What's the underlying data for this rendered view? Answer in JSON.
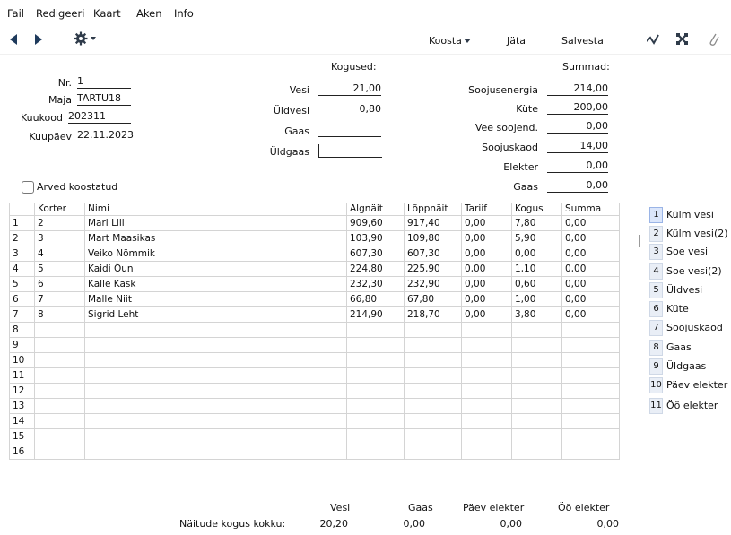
{
  "menu": [
    "Fail",
    "Redigeeri",
    "Kaart",
    "Aken",
    "Info"
  ],
  "toolbar": {
    "koosta": "Koosta",
    "jata": "Jäta",
    "salvesta": "Salvesta"
  },
  "header": {
    "nr": {
      "label": "Nr.",
      "value": "1"
    },
    "maja": {
      "label": "Maja",
      "value": "TARTU18"
    },
    "kuukood": {
      "label": "Kuukood",
      "value": "202311"
    },
    "kuupaev": {
      "label": "Kuupäev",
      "value": "22.11.2023"
    }
  },
  "kogused": {
    "title": "Kogused:",
    "rows": [
      {
        "label": "Vesi",
        "value": "21,00"
      },
      {
        "label": "Üldvesi",
        "value": "0,80"
      },
      {
        "label": "Gaas",
        "value": ""
      },
      {
        "label": "Üldgaas",
        "value": ""
      }
    ]
  },
  "summad": {
    "title": "Summad:",
    "rows": [
      {
        "label": "Soojusenergia",
        "value": "214,00"
      },
      {
        "label": "Küte",
        "value": "200,00"
      },
      {
        "label": "Vee soojend.",
        "value": "0,00"
      },
      {
        "label": "Soojuskaod",
        "value": "14,00"
      },
      {
        "label": "Elekter",
        "value": "0,00"
      },
      {
        "label": "Gaas",
        "value": "0,00"
      }
    ]
  },
  "arved_checkbox_label": "Arved koostatud",
  "table": {
    "columns": [
      "Korter",
      "Nimi",
      "Algnäit",
      "Lõppnäit",
      "Tariif",
      "Kogus",
      "Summa"
    ],
    "rows": [
      {
        "n": "1",
        "korter": "2",
        "nimi": "Mari Lill",
        "alg": "909,60",
        "lopp": "917,40",
        "tariif": "0,00",
        "kogus": "7,80",
        "summa": "0,00"
      },
      {
        "n": "2",
        "korter": "3",
        "nimi": "Mart Maasikas",
        "alg": "103,90",
        "lopp": "109,80",
        "tariif": "0,00",
        "kogus": "5,90",
        "summa": "0,00"
      },
      {
        "n": "3",
        "korter": "4",
        "nimi": "Veiko Nõmmik",
        "alg": "607,30",
        "lopp": "607,30",
        "tariif": "0,00",
        "kogus": "0,00",
        "summa": "0,00"
      },
      {
        "n": "4",
        "korter": "5",
        "nimi": "Kaidi Õun",
        "alg": "224,80",
        "lopp": "225,90",
        "tariif": "0,00",
        "kogus": "1,10",
        "summa": "0,00"
      },
      {
        "n": "5",
        "korter": "6",
        "nimi": "Kalle Kask",
        "alg": "232,30",
        "lopp": "232,90",
        "tariif": "0,00",
        "kogus": "0,60",
        "summa": "0,00"
      },
      {
        "n": "6",
        "korter": "7",
        "nimi": "Malle Niit",
        "alg": "66,80",
        "lopp": "67,80",
        "tariif": "0,00",
        "kogus": "1,00",
        "summa": "0,00"
      },
      {
        "n": "7",
        "korter": "8",
        "nimi": "Sigrid Leht",
        "alg": "214,90",
        "lopp": "218,70",
        "tariif": "0,00",
        "kogus": "3,80",
        "summa": "0,00"
      },
      {
        "n": "8",
        "korter": "",
        "nimi": "",
        "alg": "",
        "lopp": "",
        "tariif": "",
        "kogus": "",
        "summa": ""
      },
      {
        "n": "9",
        "korter": "",
        "nimi": "",
        "alg": "",
        "lopp": "",
        "tariif": "",
        "kogus": "",
        "summa": ""
      },
      {
        "n": "10",
        "korter": "",
        "nimi": "",
        "alg": "",
        "lopp": "",
        "tariif": "",
        "kogus": "",
        "summa": ""
      },
      {
        "n": "11",
        "korter": "",
        "nimi": "",
        "alg": "",
        "lopp": "",
        "tariif": "",
        "kogus": "",
        "summa": ""
      },
      {
        "n": "12",
        "korter": "",
        "nimi": "",
        "alg": "",
        "lopp": "",
        "tariif": "",
        "kogus": "",
        "summa": ""
      },
      {
        "n": "13",
        "korter": "",
        "nimi": "",
        "alg": "",
        "lopp": "",
        "tariif": "",
        "kogus": "",
        "summa": ""
      },
      {
        "n": "14",
        "korter": "",
        "nimi": "",
        "alg": "",
        "lopp": "",
        "tariif": "",
        "kogus": "",
        "summa": ""
      },
      {
        "n": "15",
        "korter": "",
        "nimi": "",
        "alg": "",
        "lopp": "",
        "tariif": "",
        "kogus": "",
        "summa": ""
      },
      {
        "n": "16",
        "korter": "",
        "nimi": "",
        "alg": "",
        "lopp": "",
        "tariif": "",
        "kogus": "",
        "summa": ""
      }
    ]
  },
  "side_tabs": [
    {
      "n": "1",
      "label": "Külm vesi"
    },
    {
      "n": "2",
      "label": "Külm vesi(2)"
    },
    {
      "n": "3",
      "label": "Soe vesi"
    },
    {
      "n": "4",
      "label": "Soe vesi(2)"
    },
    {
      "n": "5",
      "label": "Üldvesi"
    },
    {
      "n": "6",
      "label": "Küte"
    },
    {
      "n": "7",
      "label": "Soojuskaod"
    },
    {
      "n": "8",
      "label": "Gaas"
    },
    {
      "n": "9",
      "label": "Üldgaas"
    },
    {
      "n": "10",
      "label": "Päev elekter"
    },
    {
      "n": "11",
      "label": "Öö elekter"
    }
  ],
  "footer": {
    "label": "Näitude kogus kokku:",
    "cols": [
      {
        "title": "Vesi",
        "value": "20,20"
      },
      {
        "title": "Gaas",
        "value": "0,00"
      },
      {
        "title": "Päev elekter",
        "value": "0,00"
      },
      {
        "title": "Öö elekter",
        "value": "0,00"
      }
    ]
  }
}
